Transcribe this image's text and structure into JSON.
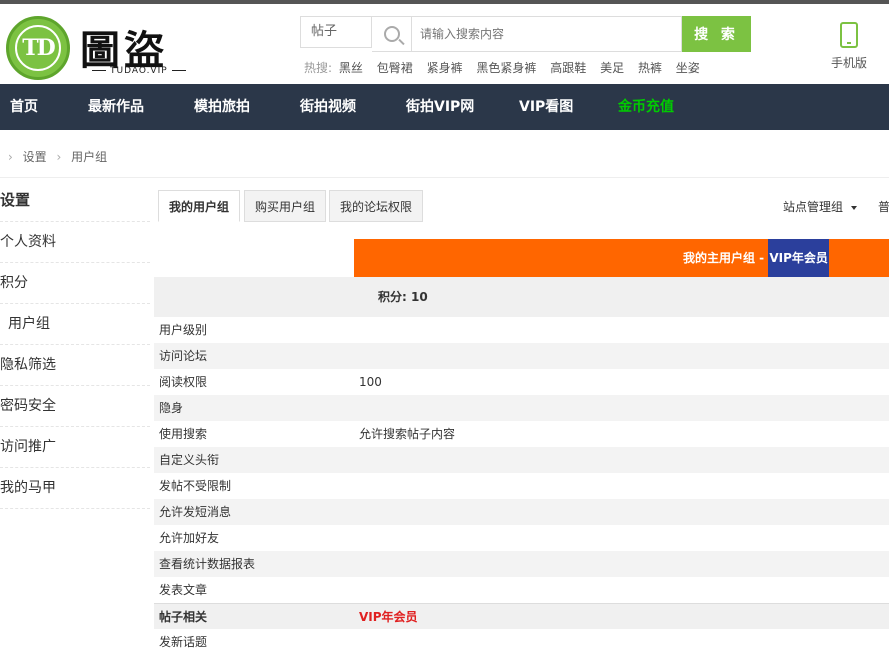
{
  "logo": {
    "text": "TD",
    "name_cn": "圖盜",
    "domain": "TUDAO.VIP"
  },
  "search": {
    "type": "帖子",
    "placeholder": "请输入搜索内容",
    "button": "搜 索",
    "hot_label": "热搜:",
    "hot_terms": [
      "黑丝",
      "包臀裙",
      "紧身裤",
      "黑色紧身裤",
      "高跟鞋",
      "美足",
      "热裤",
      "坐姿"
    ]
  },
  "mobile": {
    "label": "手机版"
  },
  "nav": [
    "首页",
    "最新作品",
    "模拍旅拍",
    "街拍视频",
    "街拍VIP网",
    "VIP看图",
    "金币充值"
  ],
  "breadcrumb": [
    "设置",
    "用户组"
  ],
  "sidebar": {
    "title": "设置",
    "items": [
      "个人资料",
      "积分",
      "用户组",
      "隐私筛选",
      "密码安全",
      "访问推广",
      "我的马甲"
    ]
  },
  "tabs": [
    "我的用户组",
    "购买用户组",
    "我的论坛权限"
  ],
  "site_admin": "站点管理组",
  "more": "普",
  "group": {
    "title_prefix": "我的主用户组 - ",
    "title_vip": "VIP年会员",
    "score": "积分: 10"
  },
  "rows": [
    {
      "k": "用户级别",
      "v": ""
    },
    {
      "k": "访问论坛",
      "v": ""
    },
    {
      "k": "阅读权限",
      "v": "100"
    },
    {
      "k": "隐身",
      "v": ""
    },
    {
      "k": "使用搜索",
      "v": "允许搜索帖子内容"
    },
    {
      "k": "自定义头衔",
      "v": ""
    },
    {
      "k": "发帖不受限制",
      "v": ""
    },
    {
      "k": "允许发短消息",
      "v": ""
    },
    {
      "k": "允许加好友",
      "v": ""
    },
    {
      "k": "查看统计数据报表",
      "v": ""
    },
    {
      "k": "发表文章",
      "v": ""
    },
    {
      "k": "帖子相关",
      "v": "VIP年会员"
    },
    {
      "k": "发新话题",
      "v": ""
    }
  ],
  "colors": {
    "brand": "#7cc242",
    "nav_bg": "#2b3749",
    "orange": "#ff6600",
    "vip_blue": "#2b3f9c",
    "gold_link": "#00cc00"
  }
}
